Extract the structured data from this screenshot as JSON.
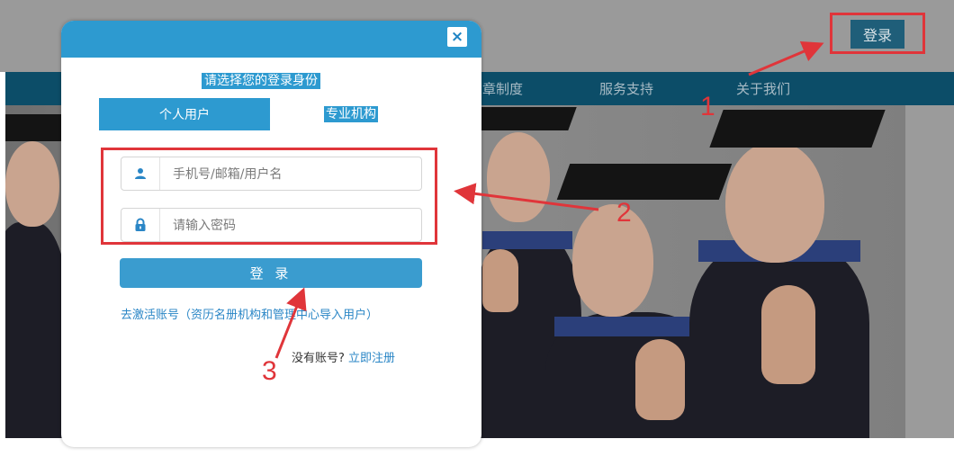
{
  "site": {
    "login_button": "登录",
    "nav_items": [
      "章制度",
      "服务支持",
      "关于我们"
    ]
  },
  "modal": {
    "close_symbol": "×",
    "title": "请选择您的登录身份",
    "tabs": {
      "personal": "个人用户",
      "organization": "专业机构"
    },
    "username_placeholder": "手机号/邮箱/用户名",
    "password_placeholder": "请输入密码",
    "login_button": "登 录",
    "activate_link": "去激活账号（资历名册机构和管理中心导入用户）",
    "no_account_text": "没有账号?",
    "register_link": "立即注册"
  },
  "annotations": {
    "one": "1",
    "two": "2",
    "three": "3"
  },
  "colors": {
    "accent_blue": "#2d9ad0",
    "annotation_red": "#e0353a",
    "nav_dark": "#0c4d68"
  },
  "icons": [
    "close-icon",
    "user-icon",
    "lock-icon"
  ]
}
